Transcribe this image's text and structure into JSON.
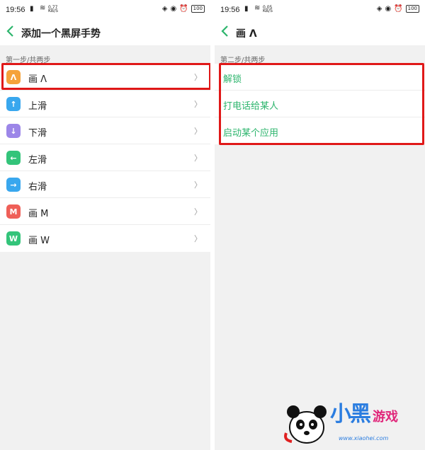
{
  "left": {
    "status": {
      "time": "19:56",
      "speed_top": "0.77",
      "speed_bottom": "KB/S",
      "battery": "100"
    },
    "header": {
      "title": "添加一个黑屏手势"
    },
    "section_label": "第一步/共两步",
    "items": [
      {
        "badge": "Λ",
        "badge_color": "#f5a23a",
        "label": "画 Λ"
      },
      {
        "badge": "↑",
        "badge_color": "#39a7ee",
        "label": "上滑"
      },
      {
        "badge": "↓",
        "badge_color": "#9c86e8",
        "label": "下滑"
      },
      {
        "badge": "←",
        "badge_color": "#33c47a",
        "label": "左滑"
      },
      {
        "badge": "→",
        "badge_color": "#39a7ee",
        "label": "右滑"
      },
      {
        "badge": "M",
        "badge_color": "#ef5f58",
        "label": "画 M"
      },
      {
        "badge": "W",
        "badge_color": "#33c47a",
        "label": "画 W"
      }
    ]
  },
  "right": {
    "status": {
      "time": "19:56",
      "speed_top": "0.05",
      "speed_bottom": "KB/S",
      "battery": "100"
    },
    "header": {
      "title": "画 Λ"
    },
    "section_label": "第二步/共两步",
    "items": [
      {
        "label": "解锁"
      },
      {
        "label": "打电话给某人"
      },
      {
        "label": "启动某个应用"
      }
    ]
  },
  "icons": {
    "back": "chevron-left-icon",
    "chevron": "chevron-right-icon"
  },
  "colors": {
    "accent": "#2db56d",
    "highlight": "#e01818"
  },
  "watermark": {
    "brand_1": "小",
    "brand_2": "黑",
    "brand_3": "游戏",
    "url": "www.xiaohei.com"
  }
}
